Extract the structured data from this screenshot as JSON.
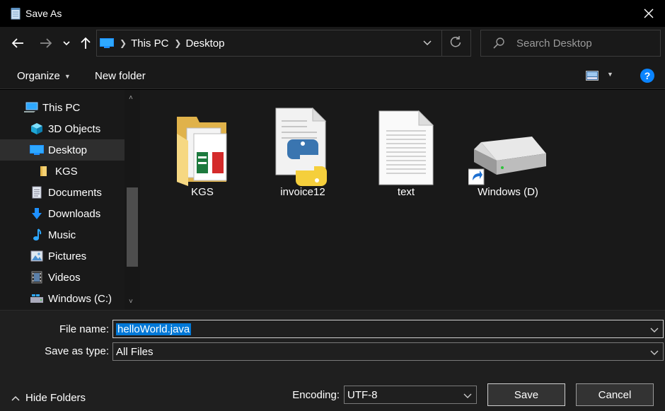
{
  "window": {
    "title": "Save As"
  },
  "address": {
    "crumbs": [
      "This PC",
      "Desktop"
    ]
  },
  "search": {
    "placeholder": "Search Desktop"
  },
  "toolbar": {
    "organize": "Organize",
    "new_folder": "New folder"
  },
  "sidebar": {
    "items": [
      {
        "label": "This PC",
        "icon": "computer-icon",
        "indent": 0
      },
      {
        "label": "3D Objects",
        "icon": "cube-icon",
        "indent": 1
      },
      {
        "label": "Desktop",
        "icon": "desktop-icon",
        "indent": 1,
        "selected": true
      },
      {
        "label": "KGS",
        "icon": "folder-icon",
        "indent": 2
      },
      {
        "label": "Documents",
        "icon": "document-icon",
        "indent": 1
      },
      {
        "label": "Downloads",
        "icon": "download-icon",
        "indent": 1
      },
      {
        "label": "Music",
        "icon": "music-note-icon",
        "indent": 1
      },
      {
        "label": "Pictures",
        "icon": "picture-icon",
        "indent": 1
      },
      {
        "label": "Videos",
        "icon": "film-icon",
        "indent": 1
      },
      {
        "label": "Windows (C:)",
        "icon": "drive-icon",
        "indent": 1
      }
    ]
  },
  "files": [
    {
      "name": "KGS",
      "icon": "folder-icon"
    },
    {
      "name": "invoice12",
      "icon": "python-file-icon"
    },
    {
      "name": "text",
      "icon": "text-file-icon"
    },
    {
      "name": "Windows (D)",
      "icon": "drive-shortcut-icon"
    }
  ],
  "form": {
    "file_name_label": "File name:",
    "file_name_value": "helloWorld.java",
    "type_label": "Save as type:",
    "type_value": "All Files",
    "encoding_label": "Encoding:",
    "encoding_value": "UTF-8"
  },
  "footer": {
    "hide_folders": "Hide Folders",
    "save": "Save",
    "cancel": "Cancel"
  },
  "colors": {
    "accent": "#0078d7",
    "background": "#191919",
    "bottom_panel": "#1f1f1f"
  }
}
